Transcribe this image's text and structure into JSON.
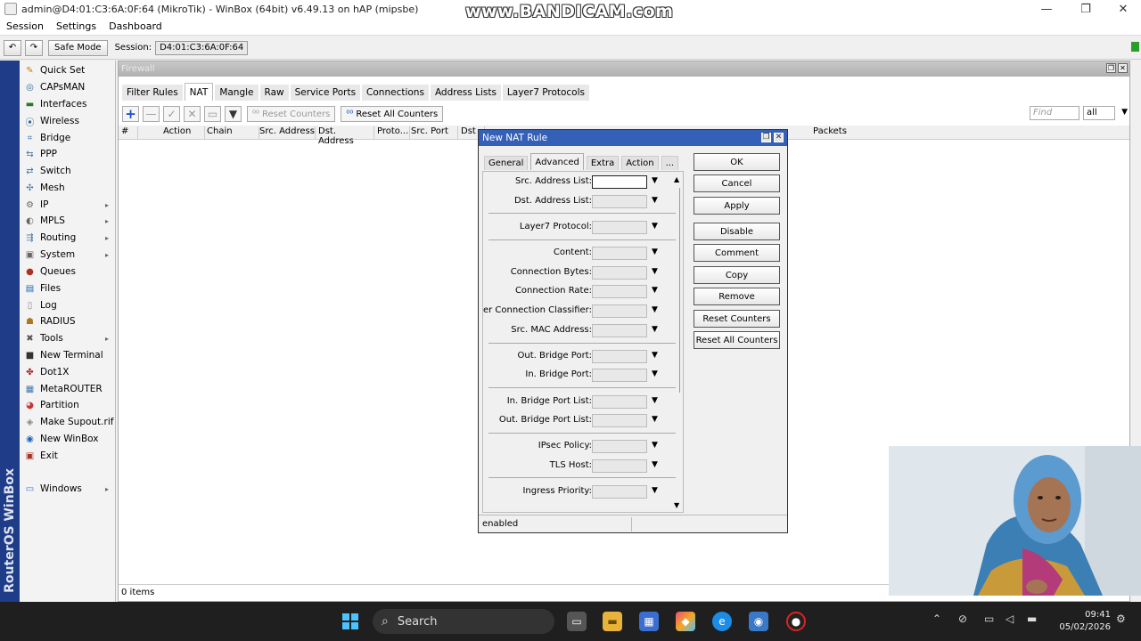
{
  "window": {
    "title": "admin@D4:01:C3:6A:0F:64 (MikroTik) - WinBox (64bit) v6.49.13 on hAP (mipsbe)",
    "watermark": "www.BANDICAM.com",
    "minimize": "—",
    "maximize": "❐",
    "close": "✕"
  },
  "menu": [
    "Session",
    "Settings",
    "Dashboard"
  ],
  "toolbar": {
    "undo": "↶",
    "redo": "↷",
    "safe_mode": "Safe Mode",
    "session_label": "Session:",
    "session_value": "D4:01:C3:6A:0F:64"
  },
  "brand": {
    "text": "RouterOS WinBox"
  },
  "sidebar": {
    "items": [
      {
        "label": "Quick Set",
        "icon": "quick-set-icon",
        "glyph": "✎",
        "color": "#c77f00",
        "arrow": false
      },
      {
        "label": "CAPsMAN",
        "icon": "capsman-icon",
        "glyph": "◎",
        "color": "#336699",
        "arrow": false
      },
      {
        "label": "Interfaces",
        "icon": "interfaces-icon",
        "glyph": "▬",
        "color": "#2a7a2a",
        "arrow": false
      },
      {
        "label": "Wireless",
        "icon": "wireless-icon",
        "glyph": "⦿",
        "color": "#336699",
        "arrow": false
      },
      {
        "label": "Bridge",
        "icon": "bridge-icon",
        "glyph": "⌗",
        "color": "#4477aa",
        "arrow": false
      },
      {
        "label": "PPP",
        "icon": "ppp-icon",
        "glyph": "⇆",
        "color": "#4477aa",
        "arrow": false
      },
      {
        "label": "Switch",
        "icon": "switch-icon",
        "glyph": "⇄",
        "color": "#4477aa",
        "arrow": false
      },
      {
        "label": "Mesh",
        "icon": "mesh-icon",
        "glyph": "✣",
        "color": "#4477aa",
        "arrow": false
      },
      {
        "label": "IP",
        "icon": "ip-icon",
        "glyph": "⚙",
        "color": "#666666",
        "arrow": true
      },
      {
        "label": "MPLS",
        "icon": "mpls-icon",
        "glyph": "◐",
        "color": "#666666",
        "arrow": true
      },
      {
        "label": "Routing",
        "icon": "routing-icon",
        "glyph": "⇶",
        "color": "#4477aa",
        "arrow": true
      },
      {
        "label": "System",
        "icon": "system-icon",
        "glyph": "▣",
        "color": "#666666",
        "arrow": true
      },
      {
        "label": "Queues",
        "icon": "queues-icon",
        "glyph": "●",
        "color": "#b03020",
        "arrow": false
      },
      {
        "label": "Files",
        "icon": "files-icon",
        "glyph": "▤",
        "color": "#2266bb",
        "arrow": false
      },
      {
        "label": "Log",
        "icon": "log-icon",
        "glyph": "▯",
        "color": "#888888",
        "arrow": false
      },
      {
        "label": "RADIUS",
        "icon": "radius-icon",
        "glyph": "☗",
        "color": "#aa7722",
        "arrow": false
      },
      {
        "label": "Tools",
        "icon": "tools-icon",
        "glyph": "✖",
        "color": "#555555",
        "arrow": true
      },
      {
        "label": "New Terminal",
        "icon": "terminal-icon",
        "glyph": "■",
        "color": "#333333",
        "arrow": false
      },
      {
        "label": "Dot1X",
        "icon": "dot1x-icon",
        "glyph": "✤",
        "color": "#aa2222",
        "arrow": false
      },
      {
        "label": "MetaROUTER",
        "icon": "metarouter-icon",
        "glyph": "▦",
        "color": "#4477aa",
        "arrow": false
      },
      {
        "label": "Partition",
        "icon": "partition-icon",
        "glyph": "◕",
        "color": "#cc3333",
        "arrow": false
      },
      {
        "label": "Make Supout.rif",
        "icon": "supout-icon",
        "glyph": "◈",
        "color": "#888888",
        "arrow": false
      },
      {
        "label": "New WinBox",
        "icon": "new-winbox-icon",
        "glyph": "◉",
        "color": "#2266bb",
        "arrow": false
      },
      {
        "label": "Exit",
        "icon": "exit-icon",
        "glyph": "▣",
        "color": "#aa3322",
        "arrow": false
      },
      {
        "label": "Windows",
        "icon": "windows-icon",
        "glyph": "▭",
        "color": "#3377cc",
        "arrow": true
      }
    ]
  },
  "firewall": {
    "title": "Firewall",
    "tabs": [
      "Filter Rules",
      "NAT",
      "Mangle",
      "Raw",
      "Service Ports",
      "Connections",
      "Address Lists",
      "Layer7 Protocols"
    ],
    "active_tab": "NAT",
    "reset_counters": "Reset Counters",
    "reset_all_counters": "Reset All Counters",
    "find_placeholder": "Find",
    "filter_value": "all",
    "columns": [
      "#",
      "Action",
      "Chain",
      "Src. Address",
      "Dst. Address",
      "Proto...",
      "Src. Port",
      "Dst",
      "Packets"
    ],
    "status": "0 items"
  },
  "dialog": {
    "title": "New NAT Rule",
    "tabs": [
      "General",
      "Advanced",
      "Extra",
      "Action",
      "..."
    ],
    "active_tab": "Advanced",
    "fields": [
      "Src. Address List:",
      "Dst. Address List:",
      "Layer7 Protocol:",
      "Content:",
      "Connection Bytes:",
      "Connection Rate:",
      "Per Connection Classifier:",
      "Src. MAC Address:",
      "Out. Bridge Port:",
      "In. Bridge Port:",
      "In. Bridge Port List:",
      "Out. Bridge Port List:",
      "IPsec Policy:",
      "TLS Host:",
      "Ingress Priority:"
    ],
    "buttons": [
      "OK",
      "Cancel",
      "Apply",
      "Disable",
      "Comment",
      "Copy",
      "Remove",
      "Reset Counters",
      "Reset All Counters"
    ],
    "status": "enabled"
  },
  "taskbar": {
    "search": "Search",
    "time": "09:41",
    "date": "05/02/2026"
  }
}
